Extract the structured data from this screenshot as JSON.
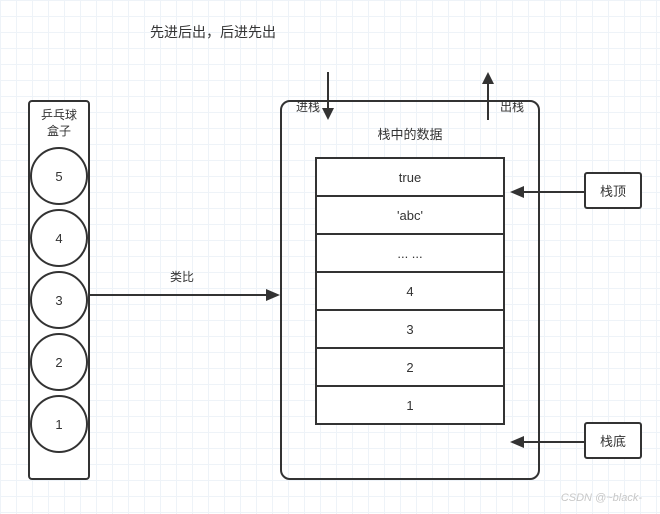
{
  "title": "先进后出，后进先出",
  "pingpong": {
    "label_line1": "乒乓球",
    "label_line2": "盒子",
    "balls": [
      "5",
      "4",
      "3",
      "2",
      "1"
    ]
  },
  "analogy_label": "类比",
  "push_label": "进栈",
  "pop_label": "出栈",
  "stack": {
    "title": "栈中的数据",
    "cells": [
      "true",
      "'abc'",
      "... ...",
      "4",
      "3",
      "2",
      "1"
    ]
  },
  "top_tag": "栈顶",
  "bottom_tag": "栈底",
  "watermark": "CSDN @~black-"
}
